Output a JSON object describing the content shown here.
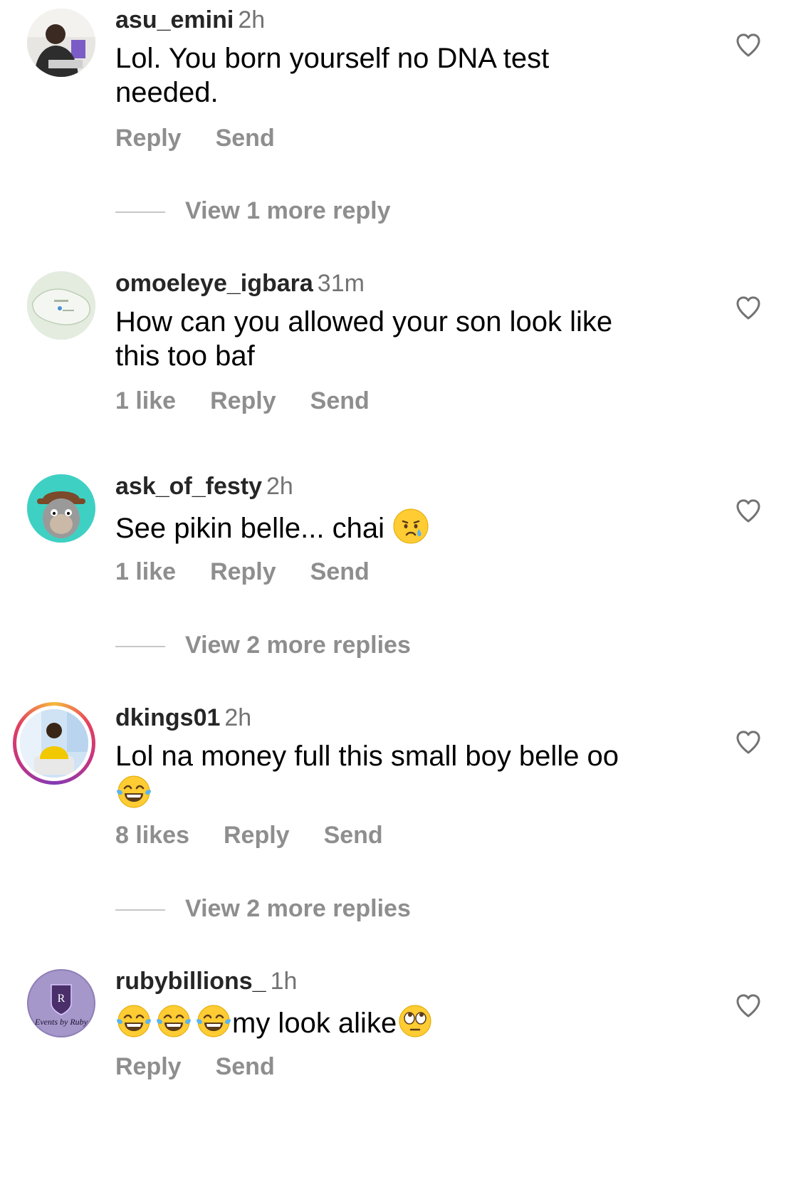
{
  "comments": [
    {
      "username": "asu_emini",
      "time": "2h",
      "text": "Lol. You born yourself no DNA test needed.",
      "likes": "",
      "reply": "Reply",
      "send": "Send",
      "view_more": "View 1 more reply"
    },
    {
      "username": "omoeleye_igbara",
      "time": "31m",
      "text": "How can you allowed your son look like this too baf",
      "likes": "1 like",
      "reply": "Reply",
      "send": "Send",
      "view_more": ""
    },
    {
      "username": "ask_of_festy",
      "time": "2h",
      "text": "See pikin belle... chai",
      "likes": "1 like",
      "reply": "Reply",
      "send": "Send",
      "view_more": "View 2 more replies"
    },
    {
      "username": "dkings01",
      "time": "2h",
      "text": "Lol na money full this small boy belle oo",
      "likes": "8 likes",
      "reply": "Reply",
      "send": "Send",
      "view_more": "View 2 more replies"
    },
    {
      "username": "rubybillions_",
      "time": "1h",
      "text": "my look alike",
      "likes": "",
      "reply": "Reply",
      "send": "Send",
      "view_more": ""
    }
  ],
  "avatar_logo_text": {
    "letter": "R",
    "brand": "Events by Ruby"
  },
  "icons": {
    "like": "heart-outline-icon",
    "emoji_cry": "crying-face-emoji",
    "emoji_laugh": "tears-of-joy-emoji",
    "emoji_eyeroll": "face-with-rolling-eyes-emoji"
  },
  "colors": {
    "username": "#262626",
    "secondary": "#737373",
    "action": "#8e8e8e",
    "story_ring": "#e4405f"
  }
}
